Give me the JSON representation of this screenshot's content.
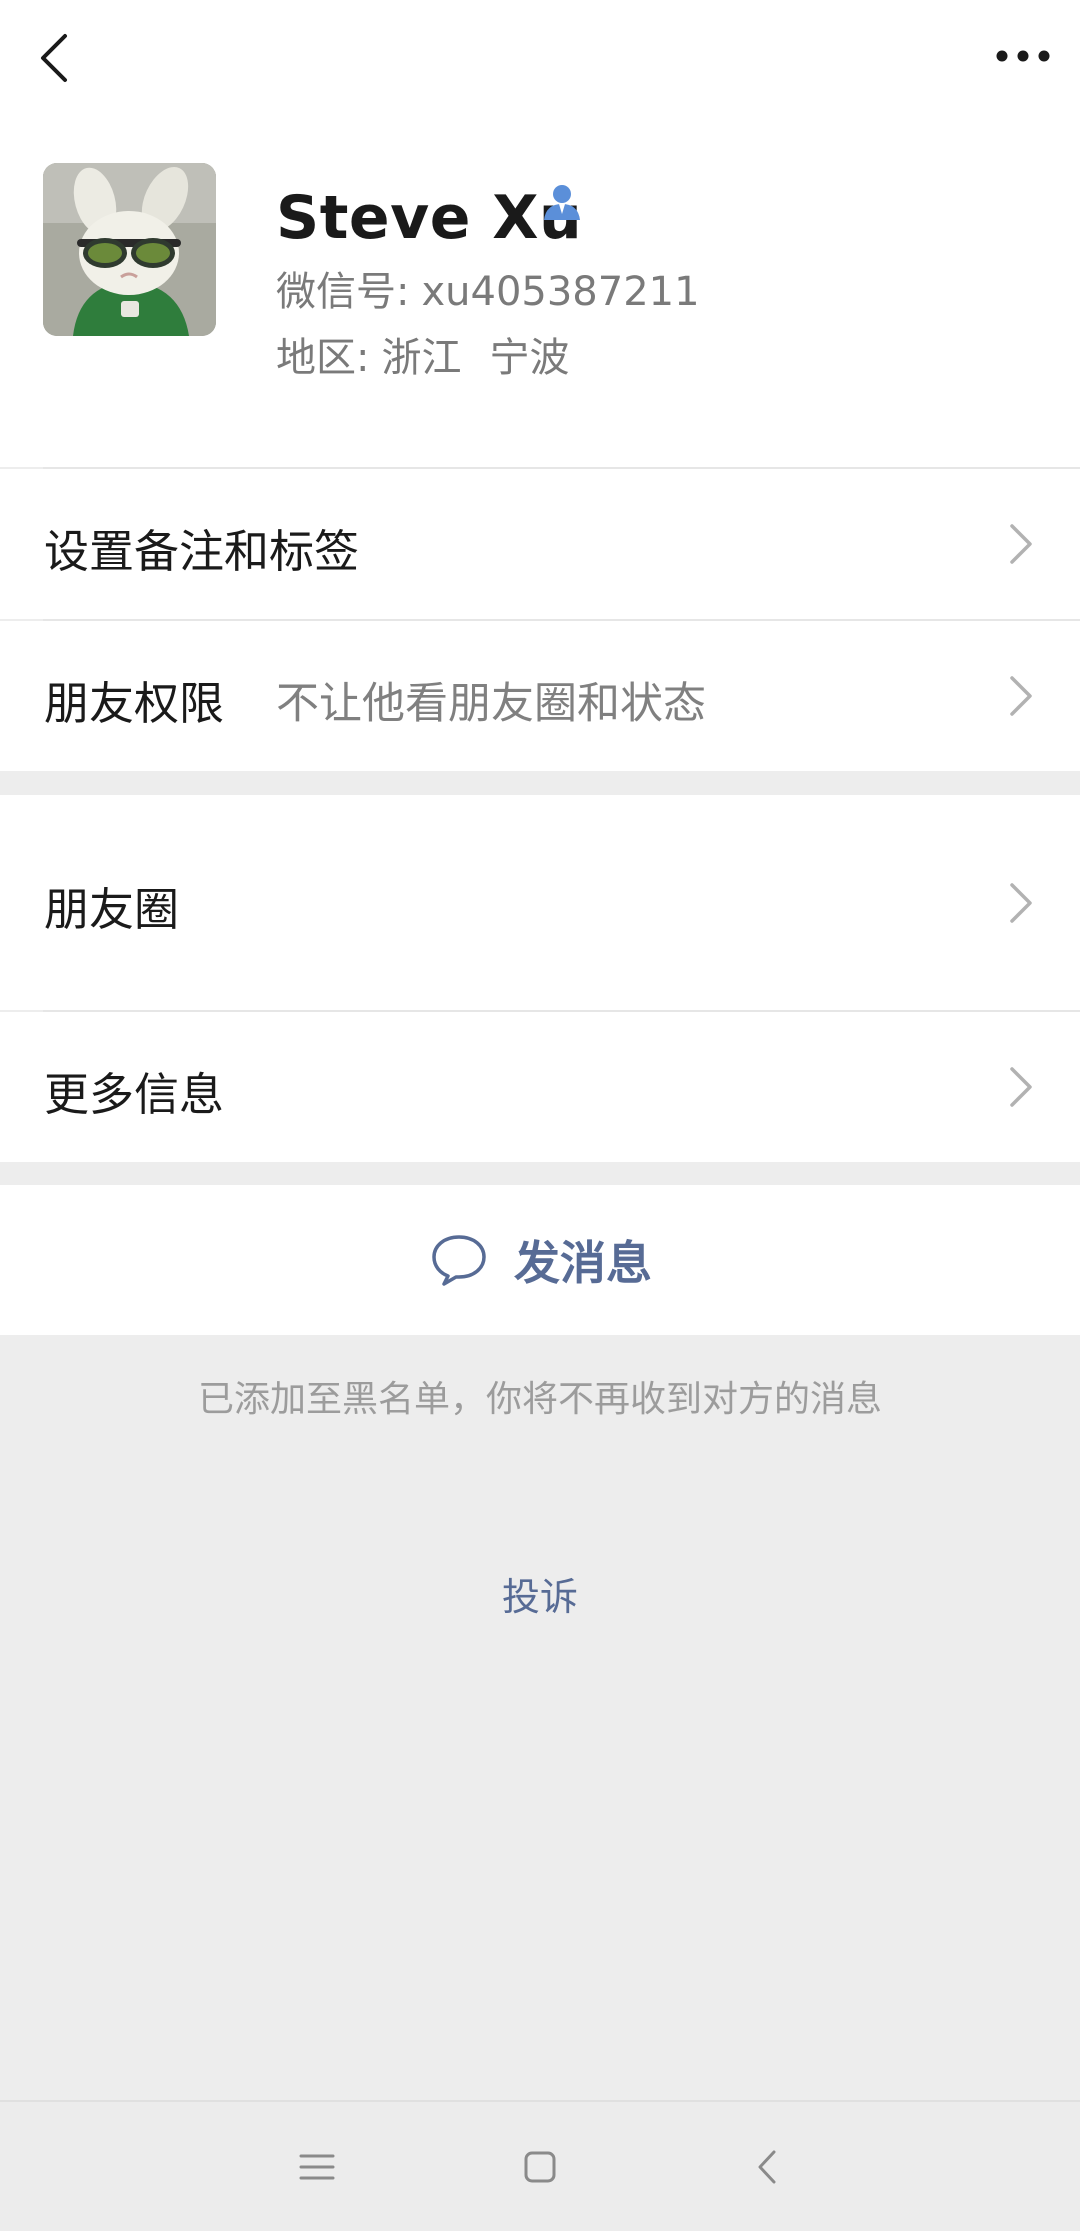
{
  "profile": {
    "name": "Steve Xu",
    "wxid_label": "微信号:",
    "wxid_value": "xu405387211",
    "region_label": "地区:",
    "region_province": "浙江",
    "region_city": "宁波"
  },
  "menu": {
    "remark_label": "设置备注和标签",
    "permission_label": "朋友权限",
    "permission_value": "不让他看朋友圈和状态",
    "moments_label": "朋友圈",
    "more_info_label": "更多信息"
  },
  "actions": {
    "send_message_label": "发消息",
    "blacklist_note": "已添加至黑名单，你将不再收到对方的消息",
    "complain_label": "投诉"
  },
  "colors": {
    "link": "#576b95",
    "background": "#ededed",
    "contact_icon": "#5b8fd9"
  },
  "icons": {
    "back": "chevron-left-icon",
    "more": "more-dots-icon",
    "contact": "contact-person-icon",
    "chevron": "chevron-right-icon",
    "chat": "chat-bubble-icon"
  }
}
